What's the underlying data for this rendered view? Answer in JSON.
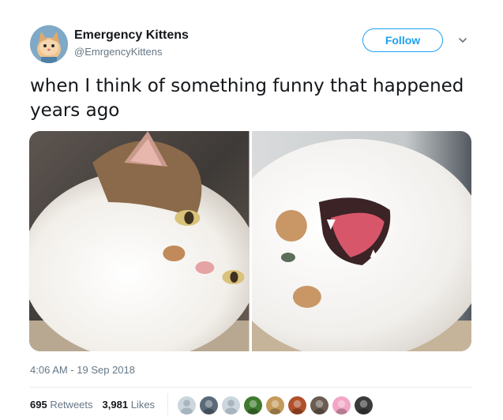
{
  "account": {
    "name": "Emergency Kittens",
    "handle": "@EmrgencyKittens",
    "avatar": "kitten-avatar-icon"
  },
  "follow_label": "Follow",
  "menu_icon": "chevron-down-icon",
  "tweet": {
    "text": "when I think of something funny that happened years ago",
    "photos": [
      {
        "icon": "cat-lying-eyes-half-open-photo"
      },
      {
        "icon": "cat-yawning-photo"
      }
    ],
    "timestamp": "4:06 AM - 19 Sep 2018"
  },
  "stats": {
    "retweets_count": "695",
    "retweets_label": "Retweets",
    "likes_count": "3,981",
    "likes_label": "Likes"
  },
  "likers": [
    {
      "icon": "default-avatar-icon",
      "color": "#a8b5bf"
    },
    {
      "icon": "person-avatar-icon",
      "color": "#5a6a78"
    },
    {
      "icon": "default-avatar-icon",
      "color": "#a8b5bf"
    },
    {
      "icon": "cartoon-avatar-icon",
      "color": "#3f7a2e"
    },
    {
      "icon": "cat-avatar-icon",
      "color": "#c59a5b"
    },
    {
      "icon": "food-avatar-icon",
      "color": "#b0502a"
    },
    {
      "icon": "figure-avatar-icon",
      "color": "#6b5d52"
    },
    {
      "icon": "pink-cat-avatar-icon",
      "color": "#f2a6c4"
    },
    {
      "icon": "dark-avatar-icon",
      "color": "#3a3a3a"
    }
  ],
  "colors": {
    "accent": "#1da1f2",
    "text": "#14171a",
    "muted": "#657786"
  }
}
